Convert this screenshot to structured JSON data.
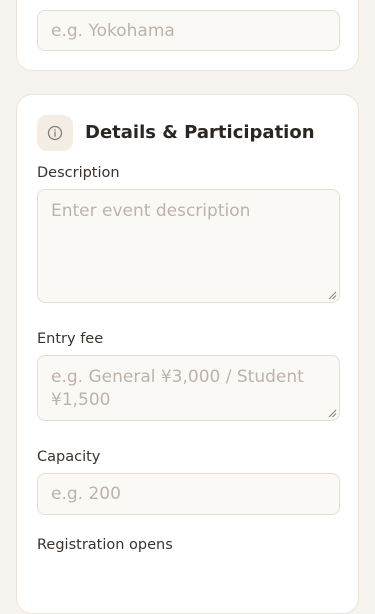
{
  "location": {
    "placeholder": "e.g. Yokohama"
  },
  "details": {
    "title": "Details & Participation",
    "icon": "info-icon",
    "description": {
      "label": "Description",
      "placeholder": "Enter event description"
    },
    "entry_fee": {
      "label": "Entry fee",
      "placeholder": "e.g. General ¥3,000 / Student ¥1,500"
    },
    "capacity": {
      "label": "Capacity",
      "placeholder": "e.g. 200"
    },
    "registration_opens": {
      "label": "Registration opens"
    }
  },
  "colors": {
    "background": "#f7f3ee",
    "card": "#ffffff",
    "border": "#e6ddd3",
    "placeholder": "#bdb3aa",
    "text": "#2b2622"
  }
}
